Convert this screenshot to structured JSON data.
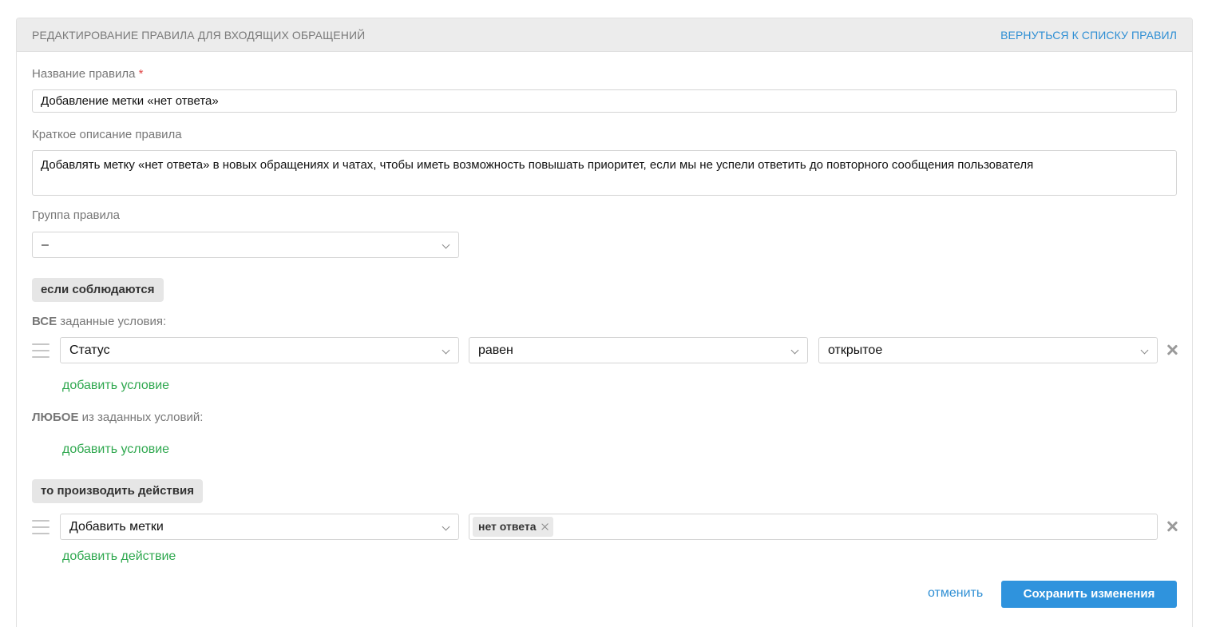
{
  "header": {
    "title": "РЕДАКТИРОВАНИЕ ПРАВИЛА ДЛЯ ВХОДЯЩИХ ОБРАЩЕНИЙ",
    "back_link": "ВЕРНУТЬСЯ К СПИСКУ ПРАВИЛ"
  },
  "form": {
    "name_label": "Название правила",
    "required_mark": "*",
    "name_value": "Добавление метки «нет ответа»",
    "description_label": "Краткое описание правила",
    "description_value": "Добавлять метку «нет ответа» в новых обращениях и чатах, чтобы иметь возможность повышать приоритет, если мы не успели ответить до повторного сообщения пользователя",
    "group_label": "Группа правила",
    "group_value": "–"
  },
  "conditions": {
    "section_label": "если соблюдаются",
    "all_caption_bold": "ВСЕ",
    "all_caption_rest": " заданные условия:",
    "all_rows": [
      {
        "field": "Статус",
        "operator": "равен",
        "value": "открытое"
      }
    ],
    "add_condition_all": "добавить условие",
    "any_caption_bold": "ЛЮБОЕ",
    "any_caption_rest": " из заданных условий:",
    "add_condition_any": "добавить условие"
  },
  "actions": {
    "section_label": "то производить действия",
    "rows": [
      {
        "action": "Добавить метки",
        "tags": [
          "нет ответа"
        ]
      }
    ],
    "add_action": "добавить действие"
  },
  "footer": {
    "cancel_label": "отменить",
    "save_label": "Сохранить изменения"
  },
  "colors": {
    "link_blue": "#2f8fd4",
    "add_green": "#2fa84f",
    "save_button": "#2f93dd",
    "required_red": "#e04545"
  }
}
